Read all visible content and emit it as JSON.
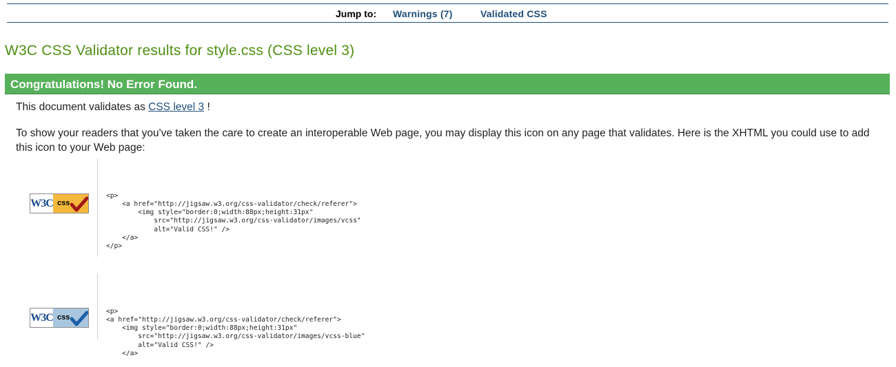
{
  "jump_nav": {
    "label": "Jump to:",
    "links": [
      "Warnings (7)",
      "Validated CSS"
    ]
  },
  "title": "W3C CSS Validator results for style.css (CSS level 3)",
  "banner": "Congratulations! No Error Found.",
  "validates": {
    "prefix": "This document validates as",
    "link": "CSS level 3",
    "suffix": "!"
  },
  "info_paragraph": "To show your readers that you've taken the care to create an interoperable Web page, you may display this icon on any page that validates. Here is the XHTML you could use to add this icon to your Web page:",
  "badges": [
    {
      "w3c": "W3C",
      "css": "css",
      "color": "#f4b93c",
      "check_color": "#a01818"
    },
    {
      "w3c": "W3C",
      "css": "css",
      "color": "#a9c6df",
      "check_color": "#1f5fa8"
    }
  ],
  "code_gold": "<p>\n    <a href=\"http://jigsaw.w3.org/css-validator/check/referer\">\n        <img style=\"border:0;width:88px;height:31px\"\n            src=\"http://jigsaw.w3.org/css-validator/images/vcss\"\n            alt=\"Valid CSS!\" />\n    </a>\n</p>",
  "code_blue": "<p>\n<a href=\"http://jigsaw.w3.org/css-validator/check/referer\">\n    <img style=\"border:0;width:88px;height:31px\"\n        src=\"http://jigsaw.w3.org/css-validator/images/vcss-blue\"\n        alt=\"Valid CSS!\" />\n    </a>"
}
